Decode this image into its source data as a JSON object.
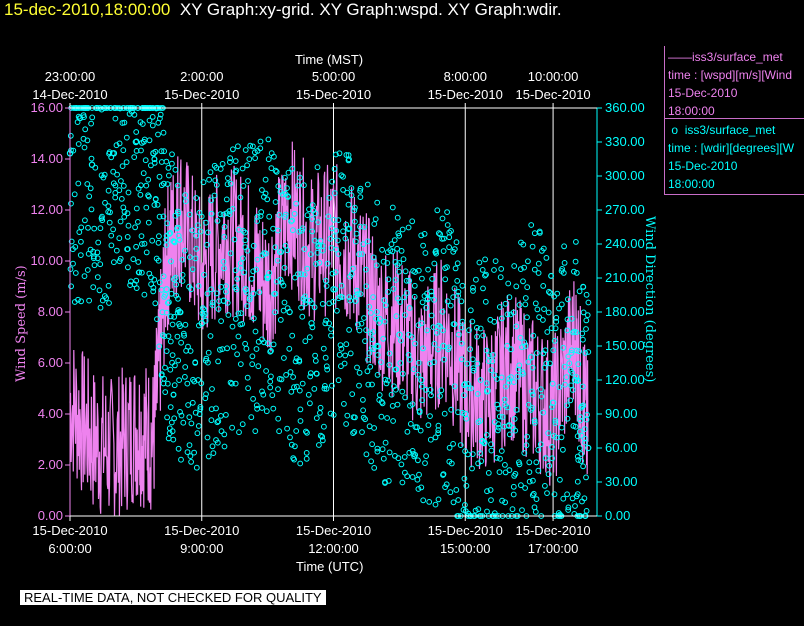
{
  "header": {
    "timestamp": "15-dec-2010,18:00:00",
    "graphs": "XY Graph:xy-grid.  XY Graph:wspd.  XY Graph:wdir."
  },
  "legend": {
    "entry1": {
      "name": "iss3/surface_met",
      "line": "time : [wspd][m/s][Wind",
      "date": "15-Dec-2010",
      "time": "18:00:00",
      "color": "#ee82ee"
    },
    "entry2": {
      "name": "iss3/surface_met",
      "line": "time : [wdir][degrees][W",
      "date": "15-Dec-2010",
      "time": "18:00:00",
      "color": "#00ffff"
    }
  },
  "banner": "REAL-TIME DATA, NOT CHECKED FOR QUALITY",
  "chart_data": {
    "type": "scatter",
    "x_top_title": "Time (MST)",
    "x_bottom_title": "Time (UTC)",
    "ylabel_left": "Wind Speed (m/s)",
    "ylabel_right": "Wind Direction (degrees)",
    "ylim_left": [
      0,
      16
    ],
    "ylim_right": [
      0,
      360
    ],
    "xlim_hours_utc": [
      6,
      18
    ],
    "grid": true,
    "left_ticks": [
      "0.00",
      "2.00",
      "4.00",
      "6.00",
      "8.00",
      "10.00",
      "12.00",
      "14.00",
      "16.00"
    ],
    "right_ticks": [
      "0.00",
      "30.00",
      "60.00",
      "90.00",
      "120.00",
      "150.00",
      "180.00",
      "210.00",
      "240.00",
      "270.00",
      "300.00",
      "330.00",
      "360.00"
    ],
    "top_ticks": [
      {
        "time": "23:00:00",
        "date": "14-Dec-2010",
        "hour_utc": 6
      },
      {
        "time": "2:00:00",
        "date": "15-Dec-2010",
        "hour_utc": 9
      },
      {
        "time": "5:00:00",
        "date": "15-Dec-2010",
        "hour_utc": 12
      },
      {
        "time": "8:00:00",
        "date": "15-Dec-2010",
        "hour_utc": 15
      },
      {
        "time": "10:00:00",
        "date": "15-Dec-2010",
        "hour_utc": 17
      }
    ],
    "bottom_ticks": [
      {
        "date": "15-Dec-2010",
        "time": "6:00:00",
        "hour_utc": 6
      },
      {
        "date": "15-Dec-2010",
        "time": "9:00:00",
        "hour_utc": 9
      },
      {
        "date": "15-Dec-2010",
        "time": "12:00:00",
        "hour_utc": 12
      },
      {
        "date": "15-Dec-2010",
        "time": "15:00:00",
        "hour_utc": 15
      },
      {
        "date": "15-Dec-2010",
        "time": "17:00:00",
        "hour_utc": 17
      }
    ],
    "series": [
      {
        "name": "iss3/surface_met wspd",
        "style": "line",
        "color": "#ee82ee",
        "x": [
          6.0,
          6.5,
          7.0,
          7.5,
          7.9,
          8.2,
          8.5,
          9.0,
          9.5,
          10.0,
          10.5,
          11.0,
          11.5,
          12.0,
          12.5,
          13.0,
          13.5,
          14.0,
          14.5,
          15.0,
          15.5,
          16.0,
          16.5,
          17.0,
          17.5,
          17.8
        ],
        "y": [
          4.5,
          3.0,
          2.5,
          3.5,
          3.0,
          10.0,
          12.0,
          9.5,
          11.0,
          10.5,
          9.0,
          12.0,
          10.5,
          11.0,
          10.0,
          8.0,
          7.5,
          6.0,
          7.5,
          5.0,
          4.5,
          6.0,
          5.0,
          4.0,
          7.0,
          3.0
        ]
      },
      {
        "name": "iss3/surface_met wdir",
        "style": "markers",
        "color": "#00ffff",
        "x": [
          6.0,
          6.5,
          7.0,
          7.5,
          7.9,
          8.2,
          8.5,
          9.0,
          9.5,
          10.0,
          10.5,
          11.0,
          11.5,
          12.0,
          12.5,
          13.0,
          13.5,
          14.0,
          14.5,
          15.0,
          15.5,
          16.0,
          16.5,
          17.0,
          17.5,
          17.8
        ],
        "y": [
          320,
          310,
          320,
          330,
          320,
          200,
          180,
          170,
          190,
          200,
          210,
          180,
          170,
          200,
          190,
          150,
          160,
          120,
          150,
          90,
          110,
          80,
          140,
          100,
          120,
          60
        ]
      }
    ]
  }
}
